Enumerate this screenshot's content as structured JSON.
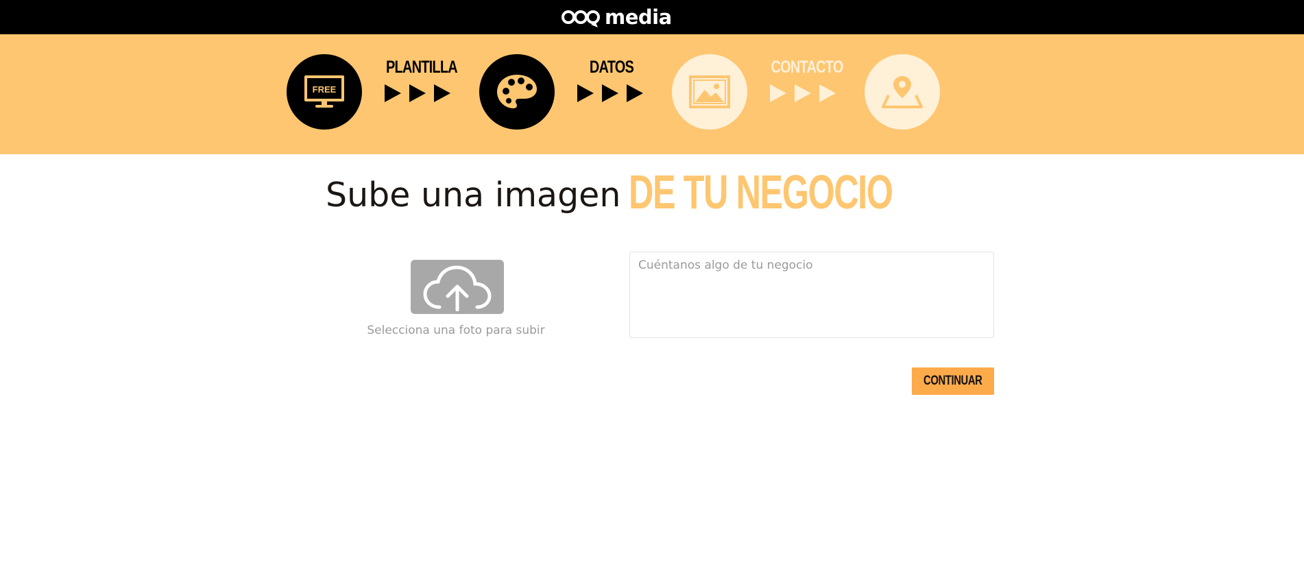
{
  "header": {
    "brand": "media",
    "logo_icon": "qdq-logo-icon"
  },
  "steps": {
    "items": [
      {
        "icon": "monitor-free-icon",
        "icon_text": "FREE",
        "state": "done"
      },
      {
        "icon": "palette-icon",
        "state": "done"
      },
      {
        "icon": "image-icon",
        "state": "pending"
      },
      {
        "icon": "map-pin-icon",
        "state": "pending"
      }
    ],
    "labels": [
      {
        "text": "PLANTILLA",
        "state": "done"
      },
      {
        "text": "DATOS",
        "state": "done"
      },
      {
        "text": "CONTACTO",
        "state": "pending"
      }
    ],
    "colors": {
      "bar": "#fec670",
      "done": "#000000",
      "pending": "#fff0d8"
    }
  },
  "main": {
    "title": "Sube una imagen",
    "title_accent": "DE TU NEGOCIO",
    "upload": {
      "icon": "cloud-upload-icon",
      "caption": "Selecciona una foto para subir"
    },
    "description": {
      "value": "",
      "placeholder": "Cuéntanos algo de tu negocio"
    },
    "continue_label": "CONTINUAR"
  },
  "colors": {
    "accent": "#fec670",
    "button": "#fdaa4b"
  }
}
